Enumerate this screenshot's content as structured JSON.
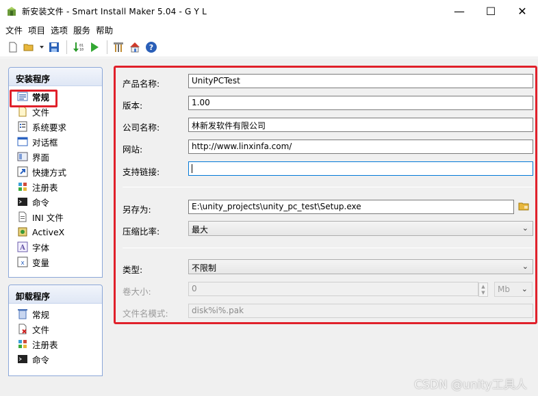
{
  "window": {
    "title": "新安装文件 - Smart Install Maker 5.04 - G Y L",
    "minimize": "—",
    "maximize": "☐",
    "close": "✕"
  },
  "menu": [
    "文件",
    "项目",
    "选项",
    "服务",
    "帮助"
  ],
  "toolbar": {
    "icons": [
      "new-file-icon",
      "open-folder-icon",
      "dropdown-arrow-icon",
      "save-icon",
      "build-icon",
      "run-icon",
      "tools-icon",
      "home-icon",
      "help-icon"
    ]
  },
  "install_panel": {
    "header": "安装程序",
    "items": [
      {
        "label": "常规",
        "icon": "general-icon"
      },
      {
        "label": "文件",
        "icon": "files-icon"
      },
      {
        "label": "系统要求",
        "icon": "requirements-icon"
      },
      {
        "label": "对话框",
        "icon": "dialogs-icon"
      },
      {
        "label": "界面",
        "icon": "interface-icon"
      },
      {
        "label": "快捷方式",
        "icon": "shortcut-icon"
      },
      {
        "label": "注册表",
        "icon": "registry-icon"
      },
      {
        "label": "命令",
        "icon": "command-icon"
      },
      {
        "label": "INI 文件",
        "icon": "ini-icon"
      },
      {
        "label": "ActiveX",
        "icon": "activex-icon"
      },
      {
        "label": "字体",
        "icon": "font-icon"
      },
      {
        "label": "变量",
        "icon": "variable-icon"
      }
    ]
  },
  "uninstall_panel": {
    "header": "卸载程序",
    "items": [
      {
        "label": "常规",
        "icon": "uninstall-general-icon"
      },
      {
        "label": "文件",
        "icon": "uninstall-files-icon"
      },
      {
        "label": "注册表",
        "icon": "uninstall-registry-icon"
      },
      {
        "label": "命令",
        "icon": "uninstall-command-icon"
      }
    ]
  },
  "form": {
    "product_name_label": "产品名称:",
    "product_name": "UnityPCTest",
    "version_label": "版本:",
    "version": "1.00",
    "company_label": "公司名称:",
    "company": "林新发软件有限公司",
    "website_label": "网站:",
    "website": "http://www.linxinfa.com/",
    "support_label": "支持链接:",
    "support": "",
    "save_as_label": "另存为:",
    "save_as": "E:\\unity_projects\\unity_pc_test\\Setup.exe",
    "compression_label": "压缩比率:",
    "compression": "最大",
    "type_label": "类型:",
    "type": "不限制",
    "volume_size_label": "卷大小:",
    "volume_size": "0",
    "volume_unit": "Mb",
    "filename_pattern_label": "文件名模式:",
    "filename_pattern": "disk%i%.pak"
  },
  "watermark": "CSDN @unity工具人"
}
